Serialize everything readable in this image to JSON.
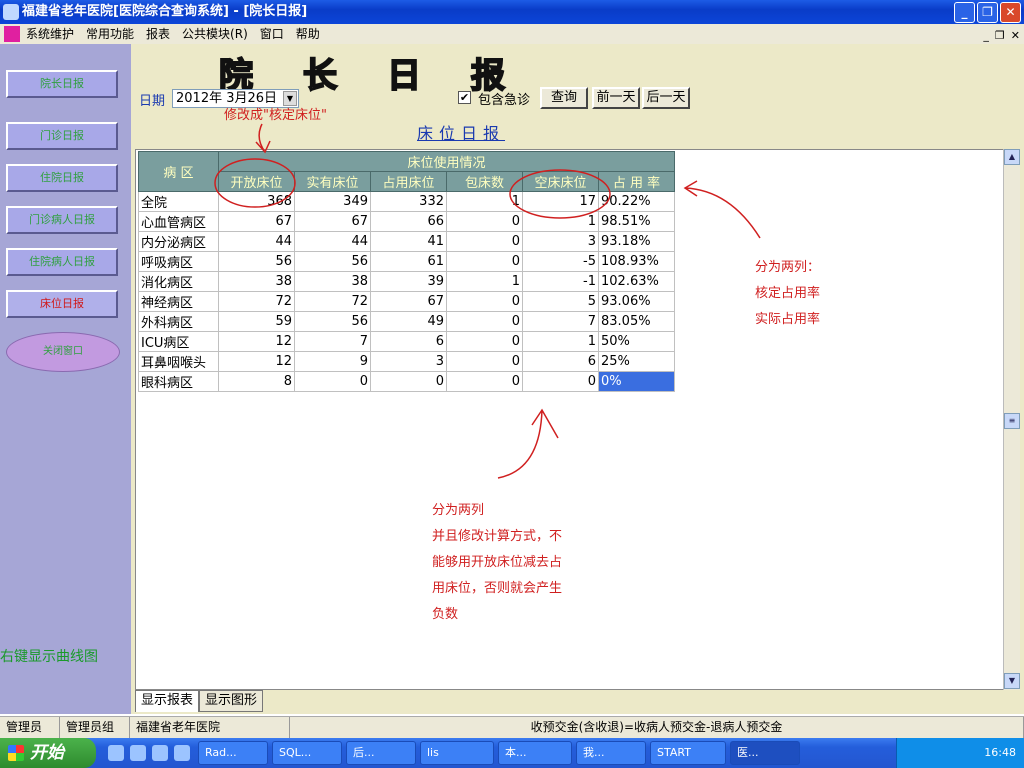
{
  "window": {
    "title": "福建省老年医院[医院综合查询系统] - [院长日报]"
  },
  "menu": [
    "系统维护",
    "常用功能",
    "报表",
    "公共模块(R)",
    "窗口",
    "帮助"
  ],
  "sidebar": {
    "items": [
      {
        "label": "院长日报"
      },
      {
        "label": "门诊日报"
      },
      {
        "label": "住院日报"
      },
      {
        "label": "门诊病人日报"
      },
      {
        "label": "住院病人日报"
      },
      {
        "label": "床位日报"
      }
    ],
    "oval_label": "关闭窗口",
    "hint": "右键显示曲线图"
  },
  "header": {
    "big_title": [
      "院",
      "长",
      "日",
      "报"
    ],
    "date_label": "日期",
    "date_value": "2012年 3月26日",
    "include_emergency_label": "包含急诊",
    "include_emergency_checked": true,
    "query_button": "查询",
    "prev_day_button": "前一天",
    "next_day_button": "后一天",
    "report_title": "床位日报"
  },
  "table": {
    "ward_header": "病  区",
    "group_header": "床位使用情况",
    "columns": [
      "开放床位",
      "实有床位",
      "占用床位",
      "包床数",
      "空床床位",
      "占 用 率"
    ],
    "rows": [
      {
        "ward": "全院",
        "open": "368",
        "actual": "349",
        "occupied": "332",
        "package": "1",
        "empty": "17",
        "rate": "90.22%"
      },
      {
        "ward": "心血管病区",
        "open": "67",
        "actual": "67",
        "occupied": "66",
        "package": "0",
        "empty": "1",
        "rate": "98.51%"
      },
      {
        "ward": "内分泌病区",
        "open": "44",
        "actual": "44",
        "occupied": "41",
        "package": "0",
        "empty": "3",
        "rate": "93.18%"
      },
      {
        "ward": "呼吸病区",
        "open": "56",
        "actual": "56",
        "occupied": "61",
        "package": "0",
        "empty": "-5",
        "rate": "108.93%"
      },
      {
        "ward": "消化病区",
        "open": "38",
        "actual": "38",
        "occupied": "39",
        "package": "1",
        "empty": "-1",
        "rate": "102.63%"
      },
      {
        "ward": "神经病区",
        "open": "72",
        "actual": "72",
        "occupied": "67",
        "package": "0",
        "empty": "5",
        "rate": "93.06%"
      },
      {
        "ward": "外科病区",
        "open": "59",
        "actual": "56",
        "occupied": "49",
        "package": "0",
        "empty": "7",
        "rate": "83.05%"
      },
      {
        "ward": "ICU病区",
        "open": "12",
        "actual": "7",
        "occupied": "6",
        "package": "0",
        "empty": "1",
        "rate": "50%"
      },
      {
        "ward": "耳鼻咽喉头",
        "open": "12",
        "actual": "9",
        "occupied": "3",
        "package": "0",
        "empty": "6",
        "rate": "25%"
      },
      {
        "ward": "眼科病区",
        "open": "8",
        "actual": "0",
        "occupied": "0",
        "package": "0",
        "empty": "0",
        "rate": "0%"
      }
    ]
  },
  "annotations": {
    "note1": "修改成\"核定床位\"",
    "note2": [
      "分为两列：",
      "核定占用率",
      "实际占用率"
    ],
    "note3": [
      "分为两列",
      "并且修改计算方式，不",
      "能够用开放床位减去占",
      "用床位，否则就会产生",
      "负数"
    ]
  },
  "tabs": [
    "显示报表",
    "显示图形"
  ],
  "statusbar": [
    "管理员",
    "管理员组",
    "福建省老年医院",
    "收预交金(含收退)=收病人预交金-退病人预交金"
  ],
  "taskbar": {
    "start": "开始",
    "tasks": [
      "Rad...",
      "SQL...",
      "后...",
      "lis",
      "本...",
      "我...",
      "START",
      "医..."
    ],
    "clock": "16:48"
  },
  "colors": {
    "annotation": "#d02020",
    "header_bg": "#7a9e9e",
    "selection": "#3a6ee0"
  }
}
